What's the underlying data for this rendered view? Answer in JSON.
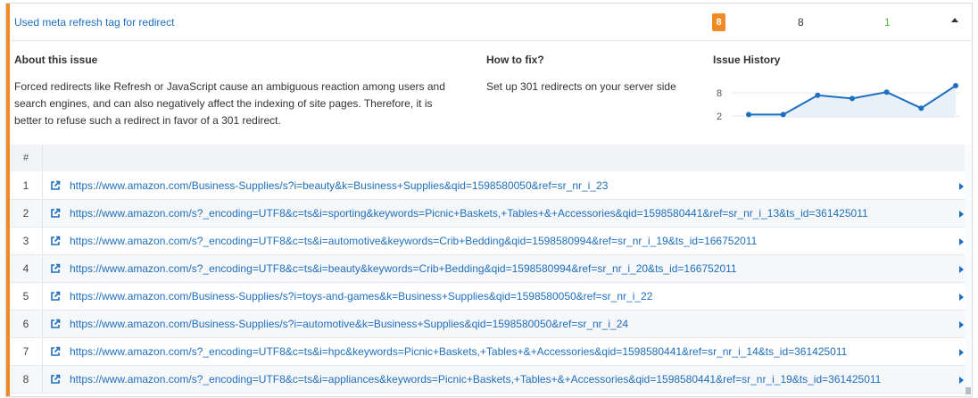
{
  "issue": {
    "title": "Used meta refresh tag for redirect",
    "badge": "8",
    "count_total": "8",
    "count_new": "1",
    "accent_color": "#f08a24",
    "new_color": "#5cae3a"
  },
  "about": {
    "heading": "About this issue",
    "text": "Forced redirects like Refresh or JavaScript cause an ambiguous reaction among users and search engines, and can also negatively affect the indexing of site pages. Therefore, it is better to refuse such a redirect in favor of a 301 redirect."
  },
  "fix": {
    "heading": "How to fix?",
    "text": "Set up 301 redirects on your server side"
  },
  "history": {
    "heading": "Issue History",
    "chart_data": {
      "type": "area",
      "y_ticks": [
        "8",
        "2"
      ],
      "values": [
        1,
        1,
        7,
        6,
        8,
        3,
        10
      ],
      "color": "#1e6fbf"
    }
  },
  "table": {
    "num_header": "#",
    "rows": [
      {
        "num": "1",
        "url": "https://www.amazon.com/Business-Supplies/s?i=beauty&k=Business+Supplies&qid=1598580050&ref=sr_nr_i_23"
      },
      {
        "num": "2",
        "url": "https://www.amazon.com/s?_encoding=UTF8&c=ts&i=sporting&keywords=Picnic+Baskets,+Tables+&+Accessories&qid=1598580441&ref=sr_nr_i_13&ts_id=361425011"
      },
      {
        "num": "3",
        "url": "https://www.amazon.com/s?_encoding=UTF8&c=ts&i=automotive&keywords=Crib+Bedding&qid=1598580994&ref=sr_nr_i_19&ts_id=166752011"
      },
      {
        "num": "4",
        "url": "https://www.amazon.com/s?_encoding=UTF8&c=ts&i=beauty&keywords=Crib+Bedding&qid=1598580994&ref=sr_nr_i_20&ts_id=166752011"
      },
      {
        "num": "5",
        "url": "https://www.amazon.com/Business-Supplies/s?i=toys-and-games&k=Business+Supplies&qid=1598580050&ref=sr_nr_i_22"
      },
      {
        "num": "6",
        "url": "https://www.amazon.com/Business-Supplies/s?i=automotive&k=Business+Supplies&qid=1598580050&ref=sr_nr_i_24"
      },
      {
        "num": "7",
        "url": "https://www.amazon.com/s?_encoding=UTF8&c=ts&i=hpc&keywords=Picnic+Baskets,+Tables+&+Accessories&qid=1598580441&ref=sr_nr_i_14&ts_id=361425011"
      },
      {
        "num": "8",
        "url": "https://www.amazon.com/s?_encoding=UTF8&c=ts&i=appliances&keywords=Picnic+Baskets,+Tables+&+Accessories&qid=1598580441&ref=sr_nr_i_19&ts_id=361425011"
      }
    ]
  },
  "icons": {
    "row_link": "external-link-icon",
    "row_expand": "chevron-right-icon",
    "collapse": "caret-up-icon"
  }
}
